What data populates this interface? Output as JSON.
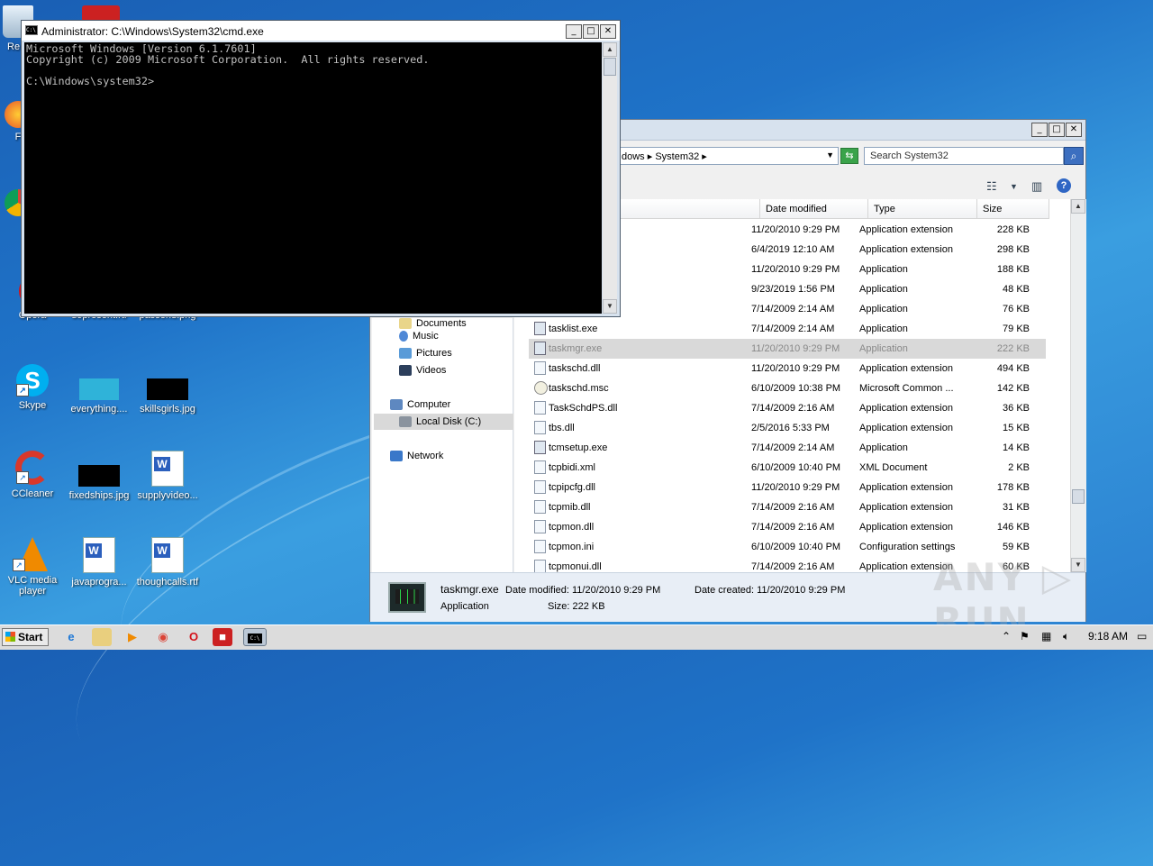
{
  "desktop": {
    "icons": [
      {
        "label": "Re",
        "emblem": "recycle-bin-icon"
      },
      {
        "label": "F",
        "emblem": "firefox-icon"
      },
      {
        "label": "Opera",
        "emblem": "opera-icon"
      },
      {
        "label": "dopresent.rtf",
        "emblem": "document-icon"
      },
      {
        "label": "passend.png",
        "emblem": "image-icon"
      },
      {
        "label": "Skype",
        "emblem": "skype-icon"
      },
      {
        "label": "everything....",
        "emblem": "image-icon"
      },
      {
        "label": "skillsgirls.jpg",
        "emblem": "image-icon"
      },
      {
        "label": "CCleaner",
        "emblem": "ccleaner-icon"
      },
      {
        "label": "fixedships.jpg",
        "emblem": "image-icon"
      },
      {
        "label": "supplyvideo...",
        "emblem": "word-icon"
      },
      {
        "label": "VLC media player",
        "emblem": "vlc-icon"
      },
      {
        "label": "javaprogra...",
        "emblem": "word-icon"
      },
      {
        "label": "thoughcalls.rtf",
        "emblem": "word-icon"
      }
    ]
  },
  "cmd": {
    "title": "Administrator: C:\\Windows\\System32\\cmd.exe",
    "lines": [
      "Microsoft Windows [Version 6.1.7601]",
      "Copyright (c) 2009 Microsoft Corporation.  All rights reserved.",
      "",
      "C:\\Windows\\system32>"
    ]
  },
  "explorer": {
    "address": "dows  ▸  System32  ▸",
    "search_placeholder": "Search System32",
    "columns": {
      "date": "Date modified",
      "type": "Type",
      "size": "Size"
    },
    "nav": {
      "documents": "Documents",
      "music": "Music",
      "pictures": "Pictures",
      "videos": "Videos",
      "computer": "Computer",
      "local_disk": "Local Disk (C:)",
      "network": "Network"
    },
    "files": [
      {
        "name": "",
        "date": "11/20/2010 9:29 PM",
        "type": "Application extension",
        "size": "228 KB",
        "kind": "dll"
      },
      {
        "name": "",
        "date": "6/4/2019 12:10 AM",
        "type": "Application extension",
        "size": "298 KB",
        "kind": "dll"
      },
      {
        "name": "",
        "date": "11/20/2010 9:29 PM",
        "type": "Application",
        "size": "188 KB",
        "kind": "app"
      },
      {
        "name": "",
        "date": "9/23/2019 1:56 PM",
        "type": "Application",
        "size": "48 KB",
        "kind": "app"
      },
      {
        "name": "",
        "date": "7/14/2009 2:14 AM",
        "type": "Application",
        "size": "76 KB",
        "kind": "app"
      },
      {
        "name": "tasklist.exe",
        "date": "7/14/2009 2:14 AM",
        "type": "Application",
        "size": "79 KB",
        "kind": "app"
      },
      {
        "name": "taskmgr.exe",
        "date": "11/20/2010 9:29 PM",
        "type": "Application",
        "size": "222 KB",
        "kind": "app",
        "selected": true
      },
      {
        "name": "taskschd.dll",
        "date": "11/20/2010 9:29 PM",
        "type": "Application extension",
        "size": "494 KB",
        "kind": "dll"
      },
      {
        "name": "taskschd.msc",
        "date": "6/10/2009 10:38 PM",
        "type": "Microsoft Common ...",
        "size": "142 KB",
        "kind": "msc"
      },
      {
        "name": "TaskSchdPS.dll",
        "date": "7/14/2009 2:16 AM",
        "type": "Application extension",
        "size": "36 KB",
        "kind": "dll"
      },
      {
        "name": "tbs.dll",
        "date": "2/5/2016 5:33 PM",
        "type": "Application extension",
        "size": "15 KB",
        "kind": "dll"
      },
      {
        "name": "tcmsetup.exe",
        "date": "7/14/2009 2:14 AM",
        "type": "Application",
        "size": "14 KB",
        "kind": "app"
      },
      {
        "name": "tcpbidi.xml",
        "date": "6/10/2009 10:40 PM",
        "type": "XML Document",
        "size": "2 KB",
        "kind": "dll"
      },
      {
        "name": "tcpipcfg.dll",
        "date": "11/20/2010 9:29 PM",
        "type": "Application extension",
        "size": "178 KB",
        "kind": "dll"
      },
      {
        "name": "tcpmib.dll",
        "date": "7/14/2009 2:16 AM",
        "type": "Application extension",
        "size": "31 KB",
        "kind": "dll"
      },
      {
        "name": "tcpmon.dll",
        "date": "7/14/2009 2:16 AM",
        "type": "Application extension",
        "size": "146 KB",
        "kind": "dll"
      },
      {
        "name": "tcpmon.ini",
        "date": "6/10/2009 10:40 PM",
        "type": "Configuration settings",
        "size": "59 KB",
        "kind": "dll"
      },
      {
        "name": "tcpmonui.dll",
        "date": "7/14/2009 2:16 AM",
        "type": "Application extension",
        "size": "60 KB",
        "kind": "dll"
      }
    ],
    "details": {
      "name": "taskmgr.exe",
      "kind": "Application",
      "modified": "Date modified: 11/20/2010 9:29 PM",
      "created": "Date created: 11/20/2010 9:29 PM",
      "size": "Size: 222 KB"
    }
  },
  "taskbar": {
    "start": "Start",
    "clock": "9:18 AM"
  },
  "watermark": "ANY ▷ RUN"
}
